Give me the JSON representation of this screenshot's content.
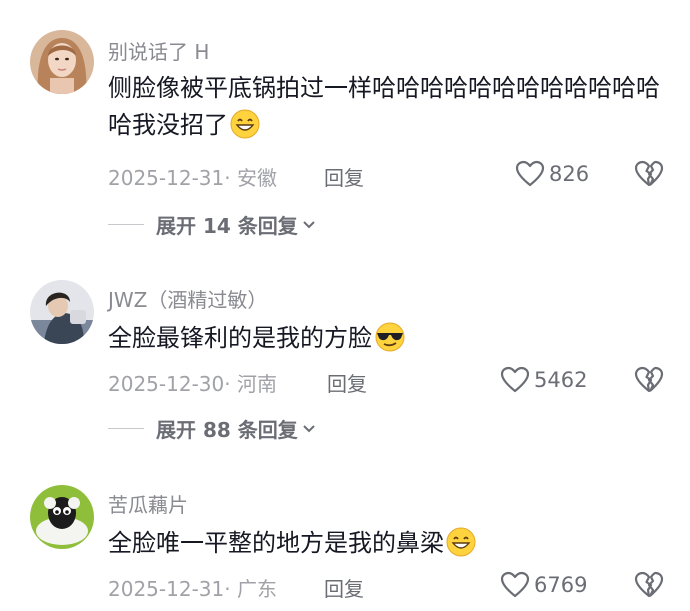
{
  "comments": [
    {
      "username": "别说话了 H",
      "text": "侧脸像被平底锅拍过一样哈哈哈哈哈哈哈哈哈哈哈哈哈我没招了",
      "emoji": "grin-emoji",
      "meta": "2025-12-31· 安徽",
      "reply_label": "回复",
      "likes": "826",
      "expand_label": "展开 14 条回复"
    },
    {
      "username": "JWZ（酒精过敏）",
      "text": "全脸最锋利的是我的方脸",
      "emoji": "sunglasses-emoji",
      "meta": "2025-12-30· 河南",
      "reply_label": "回复",
      "likes": "5462",
      "expand_label": "展开 88 条回复"
    },
    {
      "username": "苦瓜藕片",
      "text": "全脸唯一平整的地方是我的鼻梁",
      "emoji": "grin-emoji",
      "meta": "2025-12-31· 广东",
      "reply_label": "回复",
      "likes": "6769"
    }
  ],
  "icons": {
    "like": "heart-outline-icon",
    "dislike": "broken-heart-icon",
    "expand": "chevron-down-icon"
  }
}
